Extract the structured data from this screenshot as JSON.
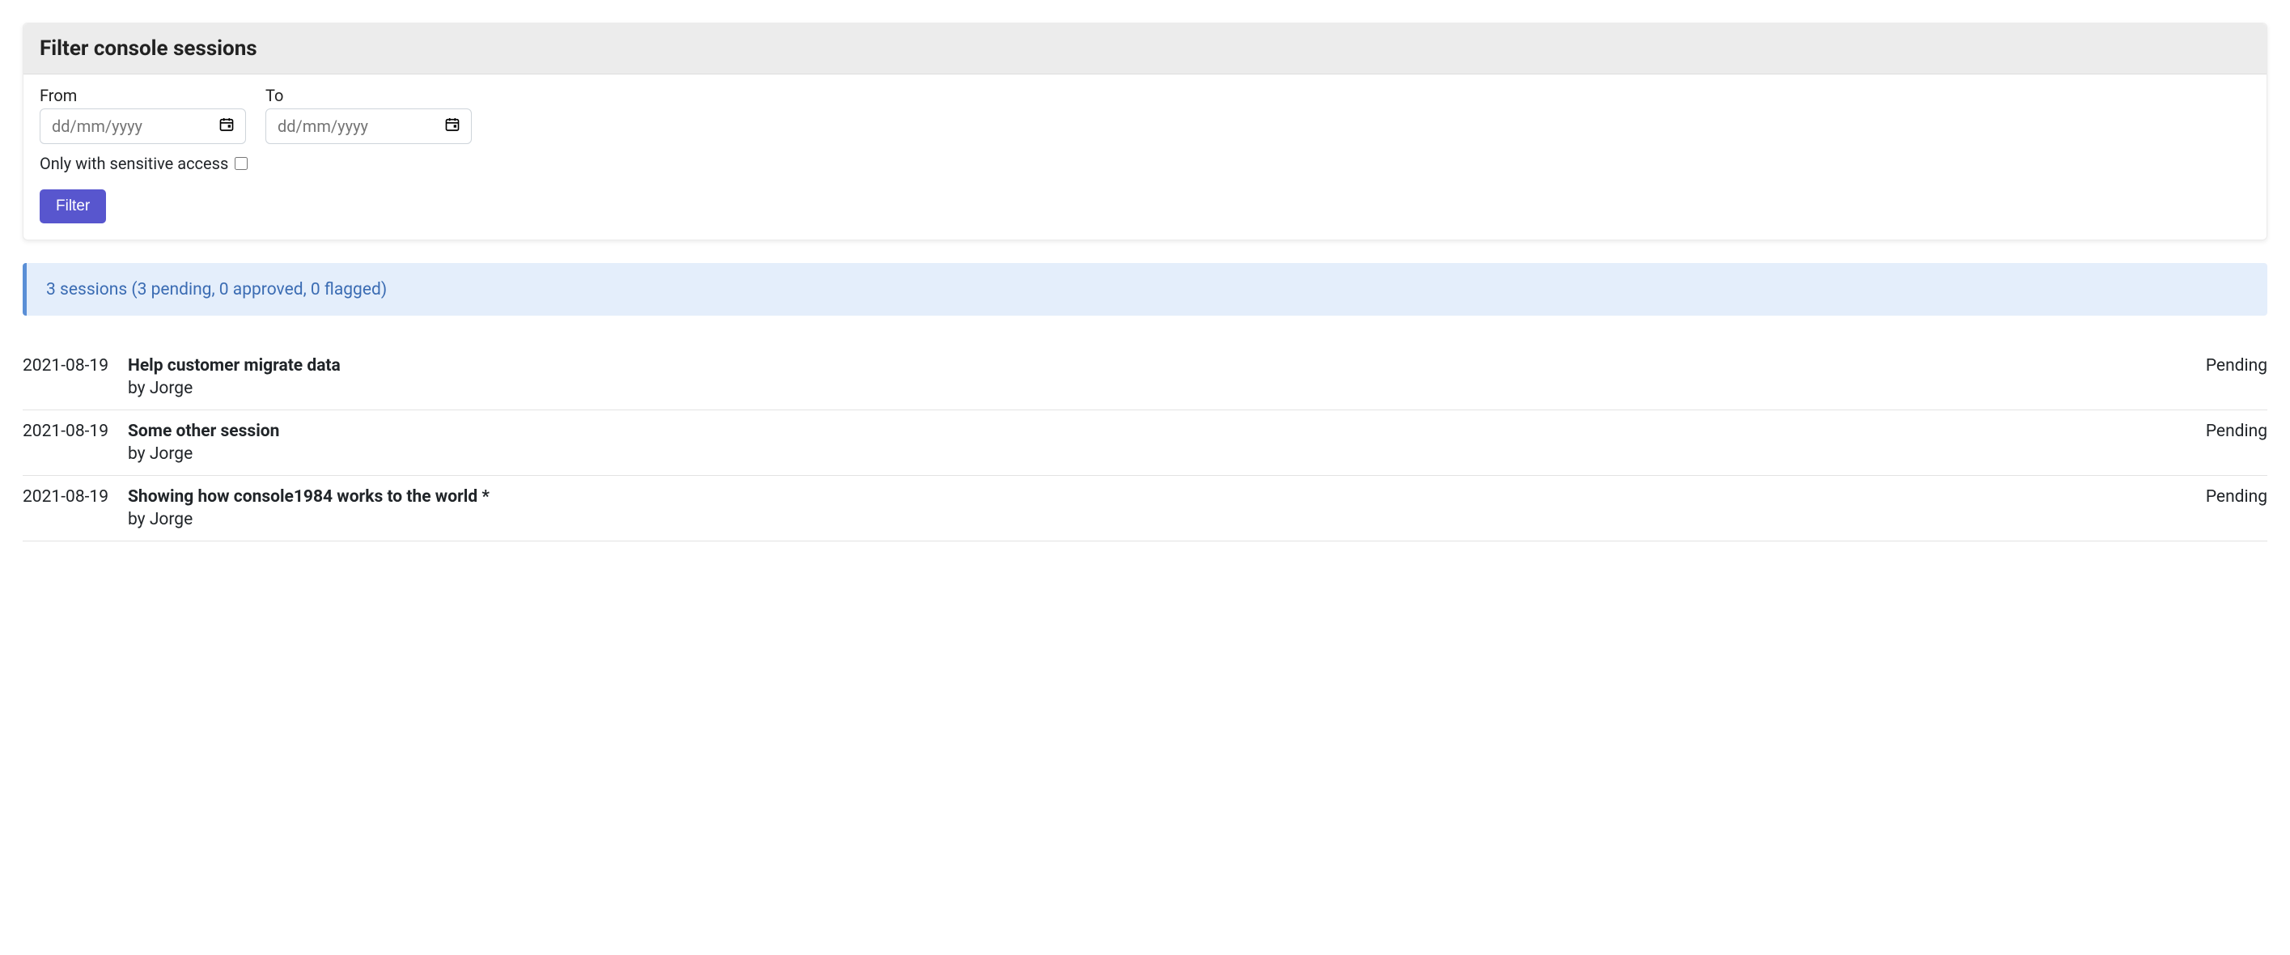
{
  "filter": {
    "heading": "Filter console sessions",
    "from_label": "From",
    "to_label": "To",
    "date_placeholder": "dd/mm/yyyy",
    "from_value": "",
    "to_value": "",
    "sensitive_label": "Only with sensitive access",
    "sensitive_checked": false,
    "submit_label": "Filter"
  },
  "summary": {
    "text": "3 sessions (3 pending, 0 approved, 0 flagged)"
  },
  "sessions": [
    {
      "date": "2021-08-19",
      "title": "Help customer migrate data",
      "by": "by Jorge",
      "status": "Pending"
    },
    {
      "date": "2021-08-19",
      "title": "Some other session",
      "by": "by Jorge",
      "status": "Pending"
    },
    {
      "date": "2021-08-19",
      "title": "Showing how console1984 works to the world *",
      "by": "by Jorge",
      "status": "Pending"
    }
  ]
}
